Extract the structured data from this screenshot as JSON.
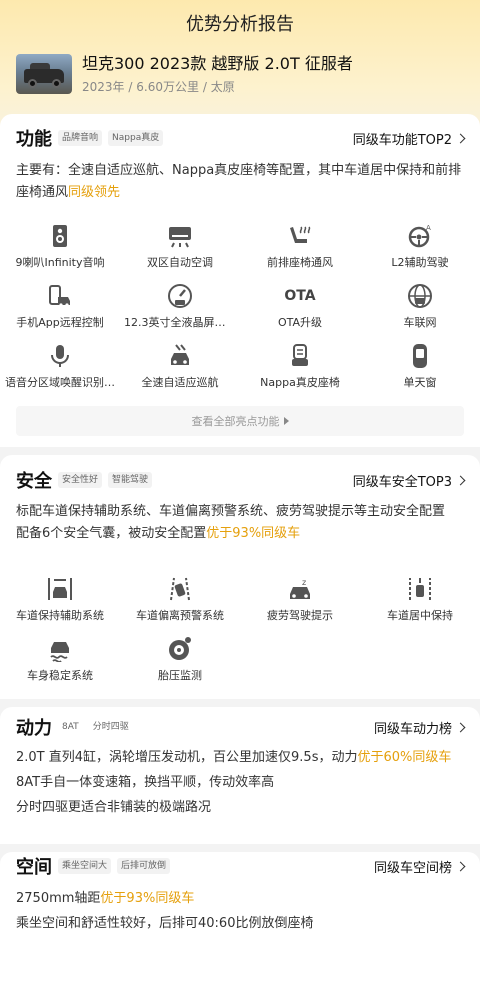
{
  "page": {
    "title": "优势分析报告"
  },
  "car": {
    "name": "坦克300 2023款 越野版 2.0T 征服者",
    "year": "2023年",
    "mileage": "6.60万公里",
    "city": "太原",
    "sep": "/"
  },
  "function": {
    "heading": "功能",
    "tags": [
      "品牌音响",
      "Nappa真皮"
    ],
    "rank": "同级车功能TOP2",
    "desc_main": "主要有：全速自适应巡航、Nappa真皮座椅等配置，其中车道居中保持和前排座椅通风",
    "desc_hl": "同级领先",
    "features": [
      {
        "label": "9喇叭Infinity音响",
        "icon": "speaker-icon"
      },
      {
        "label": "双区自动空调",
        "icon": "ac-icon"
      },
      {
        "label": "前排座椅通风",
        "icon": "seat-ventilation-icon"
      },
      {
        "label": "L2辅助驾驶",
        "icon": "steering-assist-icon"
      },
      {
        "label": "手机App远程控制",
        "icon": "phone-car-icon"
      },
      {
        "label": "12.3英寸全液晶屏幕…",
        "icon": "lcd-gauge-icon"
      },
      {
        "label": "OTA升级",
        "icon": "ota-icon"
      },
      {
        "label": "车联网",
        "icon": "connected-car-icon"
      },
      {
        "label": "语音分区域唤醒识别…",
        "icon": "microphone-icon"
      },
      {
        "label": "全速自适应巡航",
        "icon": "adaptive-cruise-icon"
      },
      {
        "label": "Nappa真皮座椅",
        "icon": "leather-seat-icon"
      },
      {
        "label": "单天窗",
        "icon": "sunroof-icon"
      }
    ],
    "more": "查看全部亮点功能",
    "ota_text": "OTA"
  },
  "safety": {
    "heading": "安全",
    "tags": [
      "安全性好",
      "智能驾驶"
    ],
    "rank": "同级车安全TOP3",
    "line1": "标配车道保持辅助系统、车道偏离预警系统、疲劳驾驶提示等主动安全配置",
    "line2_main": "配备6个安全气囊，被动安全配置",
    "line2_hl": "优于93%同级车",
    "features": [
      {
        "label": "车道保持辅助系统",
        "icon": "lane-keep-icon"
      },
      {
        "label": "车道偏离预警系统",
        "icon": "lane-departure-icon"
      },
      {
        "label": "疲劳驾驶提示",
        "icon": "fatigue-icon"
      },
      {
        "label": "车道居中保持",
        "icon": "lane-center-icon"
      },
      {
        "label": "车身稳定系统",
        "icon": "stability-icon"
      },
      {
        "label": "胎压监测",
        "icon": "tire-pressure-icon"
      }
    ]
  },
  "power": {
    "heading": "动力",
    "tags": [
      "8AT",
      "分时四驱"
    ],
    "rank": "同级车动力榜",
    "line1_main": "2.0T 直列4缸，涡轮增压发动机，百公里加速仅9.5s，动力",
    "line1_hl": "优于60%同级车",
    "line2": "8AT手自一体变速箱，换挡平顺，传动效率高",
    "line3": "分时四驱更适合非铺装的极端路况"
  },
  "space": {
    "heading": "空间",
    "tags": [
      "乘坐空间大",
      "后排可放倒"
    ],
    "rank": "同级车空间榜",
    "line1_main": "2750mm轴距",
    "line1_hl": "优于93%同级车",
    "line2": "乘坐空间和舒适性较好，后排可40:60比例放倒座椅"
  }
}
